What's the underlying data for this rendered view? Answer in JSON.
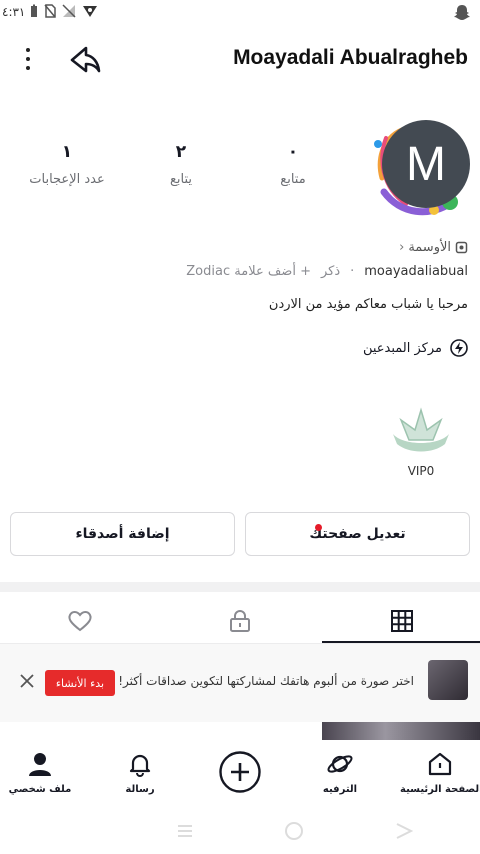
{
  "status_bar": {
    "time": "٤:٣١"
  },
  "header": {
    "title": "Moayadali Abualragheb"
  },
  "avatar": {
    "initial": "M"
  },
  "stats": [
    {
      "value": "٠",
      "label": "متابع"
    },
    {
      "value": "٢",
      "label": "يتابع"
    },
    {
      "value": "١",
      "label": "عدد الإعجابات"
    }
  ],
  "profile": {
    "badges_label": "الأوسمة",
    "handle": "moayadaliabual",
    "gender": "ذكر",
    "add_tag": "+ أضف علامة Zodiac",
    "bio": "مرحبا يا شباب معاكم مؤيد من الاردن",
    "creator_center": "مركز المبدعين",
    "vip_label": "VIP0"
  },
  "actions": {
    "edit_profile": "تعديل صفحتك",
    "add_friends": "إضافة أصدقاء"
  },
  "banner": {
    "text": "اختر صورة من ألبوم هاتفك لمشاركتها لتكوين صداقات أكثر!",
    "start_button": "بدء الأنشاء"
  },
  "bottom_nav": [
    {
      "label": "الصفحة الرئيسية",
      "icon": "home-icon"
    },
    {
      "label": "الترفيه",
      "icon": "planet-icon"
    },
    {
      "label": "",
      "icon": "plus-icon"
    },
    {
      "label": "رسالة",
      "icon": "bell-icon"
    },
    {
      "label": "ملف شخصي",
      "icon": "person-icon"
    }
  ],
  "colors": {
    "accent": "#e62b2b",
    "avatar_bg": "#434a52"
  }
}
